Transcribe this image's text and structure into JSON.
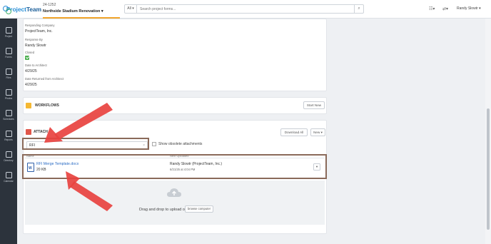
{
  "app": {
    "brand_part1": "Project",
    "brand_part2": "Team"
  },
  "project": {
    "number": "24-1252",
    "name": "Northside Stadium Renovation ▾"
  },
  "search": {
    "scope": "All ▾",
    "placeholder": "Search project forms..."
  },
  "user": {
    "name": "Randy Slowtr ▾"
  },
  "sidebar": {
    "items": [
      {
        "label": "Project",
        "icon": "home-icon"
      },
      {
        "label": "Forms",
        "icon": "forms-icon"
      },
      {
        "label": "Files",
        "icon": "folder-icon"
      },
      {
        "label": "Photos",
        "icon": "photo-icon"
      },
      {
        "label": "Schedules",
        "icon": "schedule-icon"
      },
      {
        "label": "Reports",
        "icon": "chart-icon"
      },
      {
        "label": "Directory",
        "icon": "directory-icon"
      },
      {
        "label": "Calendar",
        "icon": "calendar-icon"
      }
    ]
  },
  "details": {
    "fields": [
      {
        "label": "Responding Company",
        "value": "ProjectTeam, Inc."
      },
      {
        "label": "Response By",
        "value": "Randy Slowtr"
      },
      {
        "label": "Closed",
        "value": ""
      },
      {
        "label": "Date to Architect",
        "value": "4/29/25"
      },
      {
        "label": "Date Returned from Architect",
        "value": "4/29/25"
      }
    ]
  },
  "workflows": {
    "title": "WORKFLOWS",
    "start_new": "Start New"
  },
  "attachments": {
    "title": "ATTACH",
    "download_all": "Download All",
    "new_label": "New ▾",
    "filter_value": "RFI",
    "show_obsolete": "Show obsolete attachments",
    "col_name": "Name",
    "col_uploaded": "Next Uploaded",
    "file": {
      "name": "RFI Merge Template.docx",
      "size": "20 KB",
      "uploader": "Randy Slowtr (ProjectTeam, Inc.)",
      "time": "6/21/25 at 4:04 PM"
    },
    "dropzone_text": "Drag and drop to upload or",
    "browse_label": "browse computer"
  },
  "colors": {
    "accent": "#2b8fd6",
    "highlight": "#e8423f",
    "box": "#8a6a5a"
  }
}
